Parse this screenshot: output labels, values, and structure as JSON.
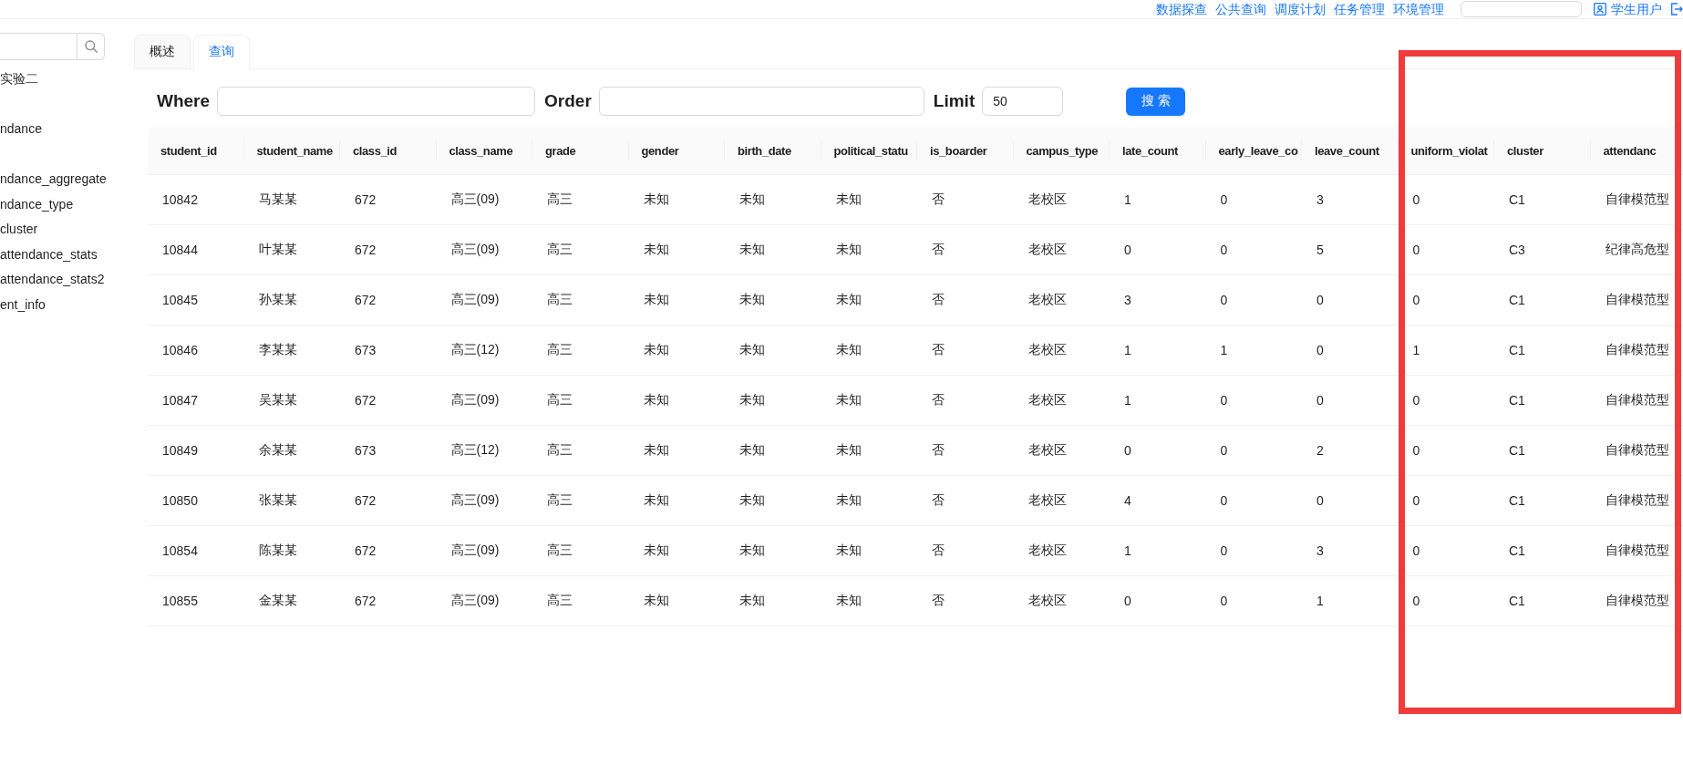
{
  "top_nav": {
    "links": [
      "数据探查",
      "公共查询",
      "调度计划",
      "任务管理",
      "环境管理"
    ],
    "user": "学生用户"
  },
  "sidebar": {
    "items": [
      "实验二",
      "ndance",
      "ndance_aggregate",
      "ndance_type",
      "cluster",
      "attendance_stats",
      "attendance_stats2",
      "ent_info"
    ]
  },
  "tabs": [
    {
      "label": "概述",
      "selected": false
    },
    {
      "label": "查询",
      "selected": true
    }
  ],
  "query": {
    "fields": [
      {
        "label": "Where"
      },
      {
        "label": "Order"
      },
      {
        "label": "Limit",
        "value": "50"
      }
    ],
    "button": "搜 索"
  },
  "table": {
    "columns": [
      "student_id",
      "student_name",
      "class_id",
      "class_name",
      "grade",
      "gender",
      "birth_date",
      "political_statu",
      "is_boarder",
      "campus_type",
      "late_count",
      "early_leave_co",
      "leave_count",
      "uniform_violat",
      "cluster",
      "attendanc"
    ],
    "rows": [
      [
        "10842",
        "马某某",
        "672",
        "高三(09)",
        "高三",
        "未知",
        "未知",
        "未知",
        "否",
        "老校区",
        "1",
        "0",
        "3",
        "0",
        "C1",
        "自律模范型"
      ],
      [
        "10844",
        "叶某某",
        "672",
        "高三(09)",
        "高三",
        "未知",
        "未知",
        "未知",
        "否",
        "老校区",
        "0",
        "0",
        "5",
        "0",
        "C3",
        "纪律高危型"
      ],
      [
        "10845",
        "孙某某",
        "672",
        "高三(09)",
        "高三",
        "未知",
        "未知",
        "未知",
        "否",
        "老校区",
        "3",
        "0",
        "0",
        "0",
        "C1",
        "自律模范型"
      ],
      [
        "10846",
        "李某某",
        "673",
        "高三(12)",
        "高三",
        "未知",
        "未知",
        "未知",
        "否",
        "老校区",
        "1",
        "1",
        "0",
        "1",
        "C1",
        "自律模范型"
      ],
      [
        "10847",
        "吴某某",
        "672",
        "高三(09)",
        "高三",
        "未知",
        "未知",
        "未知",
        "否",
        "老校区",
        "1",
        "0",
        "0",
        "0",
        "C1",
        "自律模范型"
      ],
      [
        "10849",
        "余某某",
        "673",
        "高三(12)",
        "高三",
        "未知",
        "未知",
        "未知",
        "否",
        "老校区",
        "0",
        "0",
        "2",
        "0",
        "C1",
        "自律模范型"
      ],
      [
        "10850",
        "张某某",
        "672",
        "高三(09)",
        "高三",
        "未知",
        "未知",
        "未知",
        "否",
        "老校区",
        "4",
        "0",
        "0",
        "0",
        "C1",
        "自律模范型"
      ],
      [
        "10854",
        "陈某某",
        "672",
        "高三(09)",
        "高三",
        "未知",
        "未知",
        "未知",
        "否",
        "老校区",
        "1",
        "0",
        "3",
        "0",
        "C1",
        "自律模范型"
      ],
      [
        "10855",
        "金某某",
        "672",
        "高三(09)",
        "高三",
        "未知",
        "未知",
        "未知",
        "否",
        "老校区",
        "0",
        "0",
        "1",
        "0",
        "C1",
        "自律模范型"
      ]
    ]
  }
}
